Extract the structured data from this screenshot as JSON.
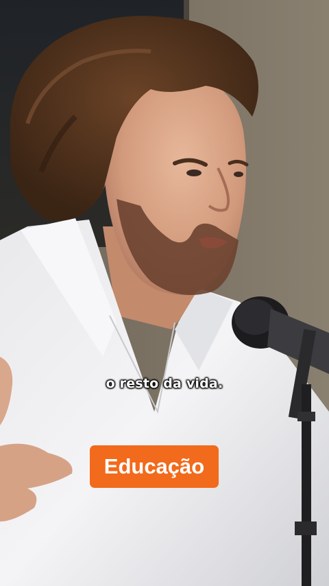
{
  "video": {
    "subtitle": "o resto da vida.",
    "category_label": "Educação"
  },
  "colors": {
    "badge_background": "#f26a1b",
    "subtitle_text": "#ffffff"
  }
}
